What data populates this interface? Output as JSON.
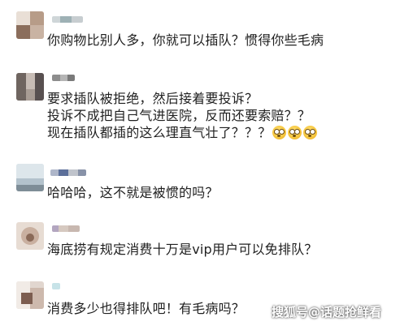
{
  "comments": [
    {
      "lines": [
        "你购物比别人多，你就可以插队？惯得你些毛病"
      ]
    },
    {
      "lines": [
        "要求插队被拒绝，然后接着要投诉？",
        "投诉不成把自己气进医院，反而还要索赔？？",
        "现在插队都插的这么理直气壮了？？？"
      ]
    },
    {
      "lines": [
        "哈哈哈，这不就是被惯的吗？"
      ]
    },
    {
      "lines": [
        "海底捞有规定消费十万是vip用户可以免排队？"
      ]
    },
    {
      "lines": [
        "消费多少也得排队吧！有毛病吗？"
      ]
    }
  ],
  "emojis": [
    "astonished-face-icon",
    "astonished-face-icon",
    "astonished-face-icon"
  ],
  "watermark": "搜狐号@话题抢鲜看"
}
